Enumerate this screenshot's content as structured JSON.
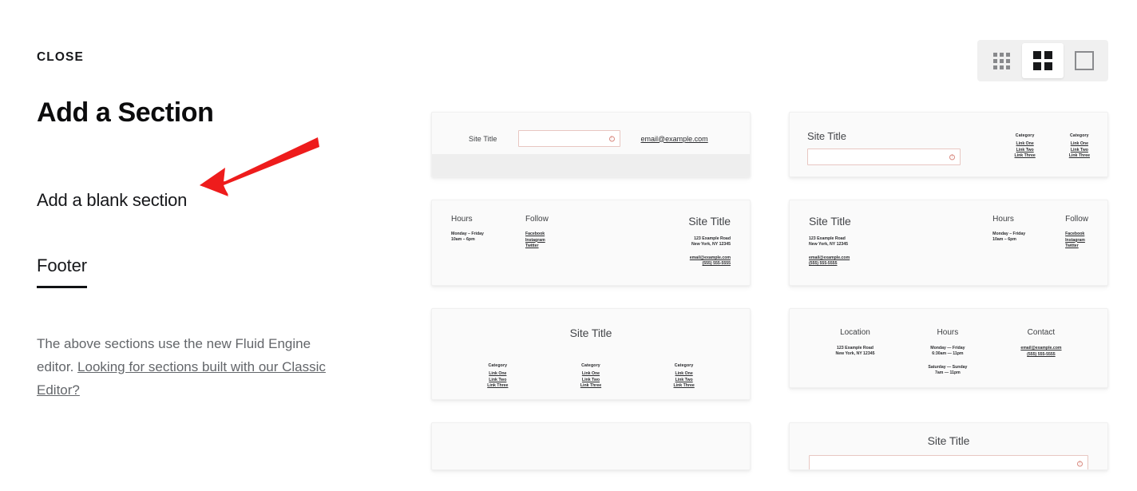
{
  "left_panel": {
    "close_label": "CLOSE",
    "title": "Add a Section",
    "blank_section_label": "Add a blank section",
    "tabs": [
      {
        "label": "Footer",
        "active": true
      }
    ],
    "helper": {
      "text_before": "The above sections use the new Fluid Engine editor. ",
      "link_text": "Looking for sections built with our Classic Editor?"
    },
    "annotation": {
      "type": "red-arrow",
      "color": "#ee1c1c"
    }
  },
  "view_toggle": {
    "options": [
      {
        "name": "grid-small",
        "icon": "grid-9-icon",
        "active": false
      },
      {
        "name": "grid-medium",
        "icon": "grid-4-icon",
        "active": true
      },
      {
        "name": "grid-large",
        "icon": "square-icon",
        "active": false
      }
    ]
  },
  "common": {
    "site_title": "Site Title",
    "email": "email@example.com",
    "phone": "(555) 555-5555",
    "address_line1": "123 Example Road",
    "address_line2": "New York, NY 12345",
    "category_label": "Category",
    "links": [
      "Link One",
      "Link Two",
      "Link Three"
    ],
    "hours_label": "Hours",
    "follow_label": "Follow",
    "location_label": "Location",
    "contact_label": "Contact",
    "hours_weekday": "Monday – Friday",
    "hours_weekday_time": "10am – 6pm",
    "hours_weekday_alt": "Monday — Friday",
    "hours_weekday_alt_time": "6:30am — 11pm",
    "hours_weekend": "Saturday — Sunday",
    "hours_weekend_time": "7am — 11pm",
    "social": [
      "Facebook",
      "Instagram",
      "Twitter"
    ]
  },
  "cards": [
    {
      "id": "footer-newsletter-inline",
      "layout": "title-input-email"
    },
    {
      "id": "footer-newsletter-links",
      "layout": "title-input-two-category"
    },
    {
      "id": "footer-hours-follow-left",
      "layout": "hours-follow-then-title"
    },
    {
      "id": "footer-title-hours-follow",
      "layout": "title-then-hours-follow"
    },
    {
      "id": "footer-centered-three-category",
      "layout": "centered-title-three-category"
    },
    {
      "id": "footer-location-hours-contact",
      "layout": "three-column-info"
    },
    {
      "id": "footer-partial-left",
      "layout": "partial"
    },
    {
      "id": "footer-centered-newsletter",
      "layout": "centered-title-input"
    }
  ]
}
